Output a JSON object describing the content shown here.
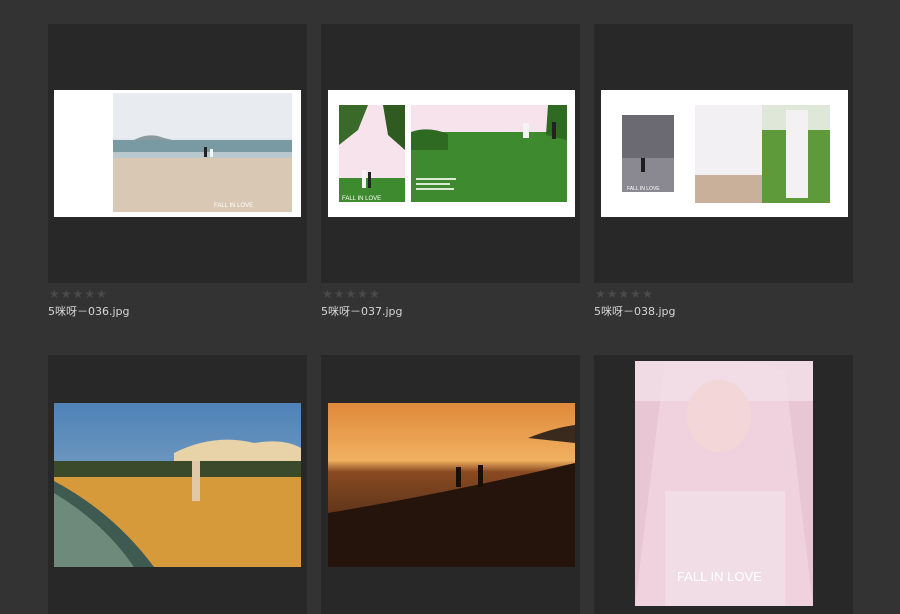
{
  "thumbnails": [
    {
      "filename": "5咪呀－036.jpg",
      "rating": 0,
      "overlay_text": "FALL IN LOVE",
      "colors": {
        "sky": "#e3e6ec",
        "sea": "#7a9aa3",
        "sand": "#d8c8b4",
        "island": "#8a9ba0"
      }
    },
    {
      "filename": "5咪呀－037.jpg",
      "rating": 0,
      "overlay_text": "FALL IN LOVE",
      "colors": {
        "grass": "#3e8a2e",
        "sky": "#f6e3ec",
        "palm": "#3a6a2a"
      }
    },
    {
      "filename": "5咪呀－038.jpg",
      "rating": 0,
      "overlay_text": "FALL IN LOVE",
      "colors": {
        "beach": "#6b6a72",
        "dress": "#f2f0f2",
        "grass": "#5f9a3a"
      }
    },
    {
      "filename": "",
      "rating": 0,
      "colors": {
        "sky": "#4f82b8",
        "cloud": "#e8d2a8",
        "sand": "#d69a3a",
        "water": "#3f5a50"
      }
    },
    {
      "filename": "",
      "rating": 0,
      "colors": {
        "sky_top": "#3a2a1e",
        "sunset": "#e08a3a",
        "water": "#2a1a12"
      }
    },
    {
      "filename": "",
      "rating": 0,
      "overlay_text": "FALL IN LOVE",
      "colors": {
        "veil": "#f4dde6",
        "skin": "#f0cfc8",
        "bg": "#e9c6d4"
      }
    }
  ],
  "star_glyph": "★"
}
